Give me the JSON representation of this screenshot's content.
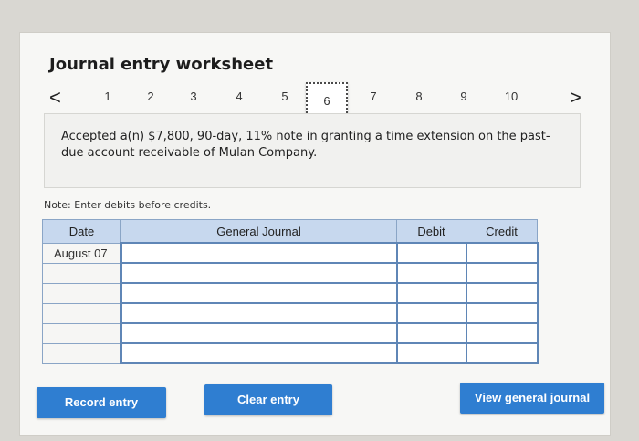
{
  "worksheet": {
    "title": "Journal entry worksheet"
  },
  "pager": {
    "prev": "<",
    "next": ">",
    "pages": [
      "1",
      "2",
      "3",
      "4",
      "5",
      "6",
      "7",
      "8",
      "9",
      "10"
    ],
    "active": "6"
  },
  "transaction": {
    "description": "Accepted a(n) $7,800, 90-day, 11% note in granting a time extension on the past-due account receivable of Mulan Company."
  },
  "note": "Note: Enter debits before credits.",
  "table": {
    "headers": {
      "date": "Date",
      "account": "General Journal",
      "debit": "Debit",
      "credit": "Credit"
    },
    "rows": [
      {
        "date": "August 07",
        "account": "",
        "debit": "",
        "credit": ""
      },
      {
        "date": "",
        "account": "",
        "debit": "",
        "credit": ""
      },
      {
        "date": "",
        "account": "",
        "debit": "",
        "credit": ""
      },
      {
        "date": "",
        "account": "",
        "debit": "",
        "credit": ""
      },
      {
        "date": "",
        "account": "",
        "debit": "",
        "credit": ""
      },
      {
        "date": "",
        "account": "",
        "debit": "",
        "credit": ""
      }
    ]
  },
  "buttons": {
    "record": "Record entry",
    "clear": "Clear entry",
    "view": "View general journal"
  }
}
